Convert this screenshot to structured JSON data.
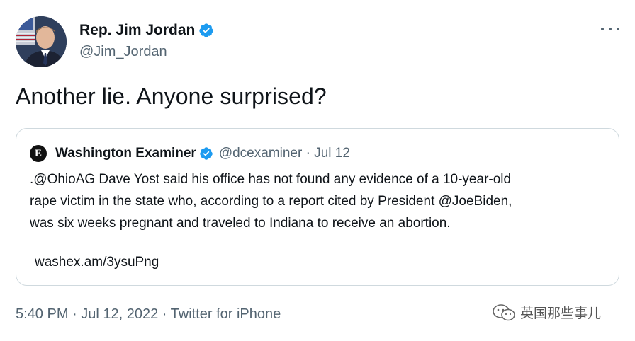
{
  "author": {
    "display_name": "Rep. Jim Jordan",
    "handle": "@Jim_Jordan",
    "verified": true
  },
  "tweet": {
    "text": "Another lie. Anyone surprised?"
  },
  "quoted_tweet": {
    "logo_letter": "E",
    "display_name": "Washington Examiner",
    "verified": true,
    "meta": "@dcexaminer · Jul 12",
    "lines": [
      ".@OhioAG Dave Yost said his office has not found any evidence of a 10-year-old",
      "rape victim in the state who, according to a report cited by President @JoeBiden,",
      "was six weeks pregnant and traveled to Indiana to receive an abortion."
    ],
    "link": "washex.am/3ysuPng"
  },
  "footer": {
    "timestamp": "5:40 PM · Jul 12, 2022 · Twitter for iPhone"
  },
  "watermark": {
    "text": "英国那些事儿"
  },
  "colors": {
    "verified": "#1d9bf0",
    "secondary_text": "#536471",
    "border": "#cfd9de"
  },
  "icons": [
    "verified-badge-icon",
    "more-icon",
    "wechat-icon"
  ]
}
